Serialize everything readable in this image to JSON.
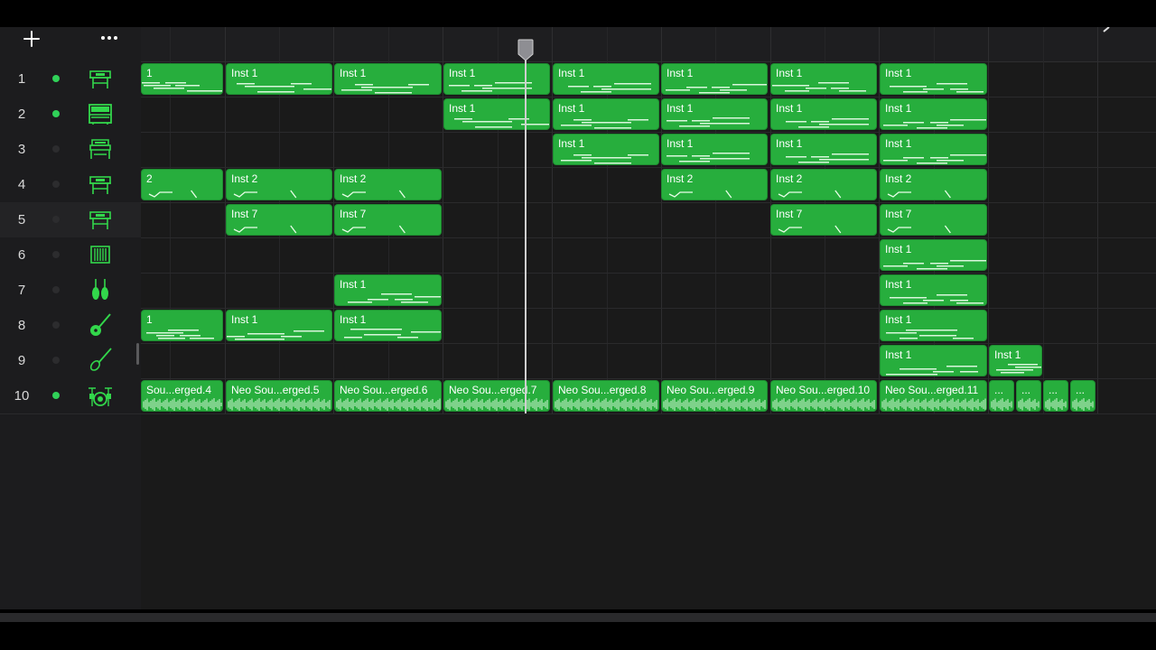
{
  "header": {
    "add_icon": "plus-icon",
    "more_icon": "ellipsis-icon"
  },
  "colors": {
    "region_green": "#27ae3d",
    "active_dot": "#30d158",
    "inactive_dot": "#2c2c2e",
    "icon_green": "#32d74b"
  },
  "tracks": [
    {
      "number": "1",
      "active": true,
      "icon": "keyboard-icon"
    },
    {
      "number": "2",
      "active": true,
      "icon": "upright-piano-icon"
    },
    {
      "number": "3",
      "active": false,
      "icon": "organ-icon"
    },
    {
      "number": "4",
      "active": false,
      "icon": "keyboard-icon"
    },
    {
      "number": "5",
      "active": false,
      "icon": "keyboard-icon"
    },
    {
      "number": "6",
      "active": false,
      "icon": "mallet-icon"
    },
    {
      "number": "7",
      "active": false,
      "icon": "strings-icon"
    },
    {
      "number": "8",
      "active": false,
      "icon": "acoustic-guitar-icon"
    },
    {
      "number": "9",
      "active": false,
      "icon": "bass-guitar-icon"
    },
    {
      "number": "10",
      "active": true,
      "icon": "drum-kit-icon"
    }
  ],
  "regions": {
    "track1": [
      "1",
      "Inst 1",
      "Inst 1",
      "Inst 1",
      "Inst 1",
      "Inst 1",
      "Inst 1",
      "Inst 1"
    ],
    "track2": [
      "Inst 1",
      "Inst 1",
      "Inst 1",
      "Inst 1",
      "Inst 1"
    ],
    "track3": [
      "Inst 1",
      "Inst 1",
      "Inst 1",
      "Inst 1"
    ],
    "track4": [
      "2",
      "Inst 2",
      "Inst 2",
      "Inst 2",
      "Inst 2",
      "Inst 2"
    ],
    "track5": [
      "Inst 7",
      "Inst 7",
      "Inst 7",
      "Inst 7"
    ],
    "track6": [
      "Inst 1"
    ],
    "track7": [
      "Inst 1",
      "Inst 1"
    ],
    "track8": [
      "1",
      "Inst 1",
      "Inst 1",
      "Inst 1"
    ],
    "track9": [
      "Inst 1",
      "Inst 1"
    ],
    "track10": [
      "Sou...erged.4",
      "Neo Sou...erged.5",
      "Neo Sou...erged.6",
      "Neo Sou...erged.7",
      "Neo Sou...erged.8",
      "Neo Sou...erged.9",
      "Neo Sou...erged.10",
      "Neo Sou...erged.11",
      "...",
      "...",
      "...",
      "..."
    ]
  }
}
